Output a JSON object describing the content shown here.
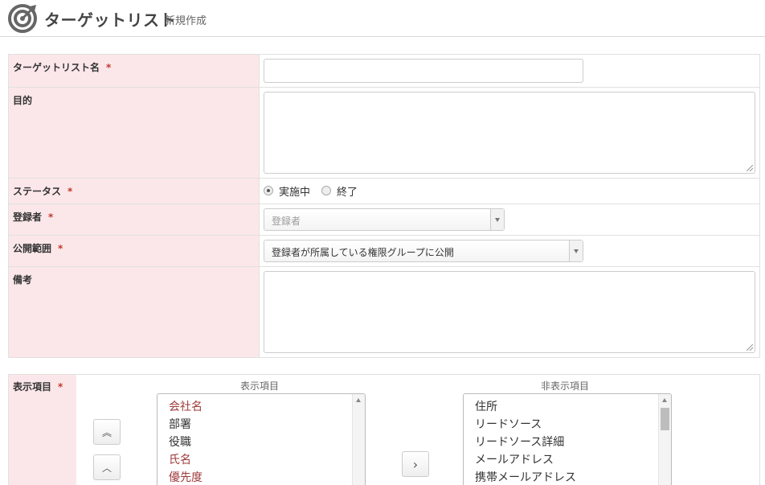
{
  "header": {
    "title": "ターゲットリスト",
    "subtitle": "新規作成",
    "icon": "target-icon"
  },
  "form": {
    "required_mark": "*",
    "name_label": "ターゲットリスト名",
    "name_value": "",
    "purpose_label": "目的",
    "purpose_value": "",
    "status_label": "ステータス",
    "status_options": [
      {
        "label": "実施中",
        "checked": true
      },
      {
        "label": "終了",
        "checked": false
      }
    ],
    "registrant_label": "登録者",
    "registrant_placeholder": "登録者",
    "scope_label": "公開範囲",
    "scope_value": "登録者が所属している権限グループに公開",
    "notes_label": "備考",
    "notes_value": ""
  },
  "display_items": {
    "label": "表示項目",
    "shown_title": "表示項目",
    "hidden_title": "非表示項目",
    "shown": [
      "会社名",
      "部署",
      "役職",
      "氏名",
      "優先度"
    ],
    "shown_red": [
      true,
      false,
      false,
      true,
      true
    ],
    "hidden": [
      "住所",
      "リードソース",
      "リードソース詳細",
      "メールアドレス",
      "携帯メールアドレス"
    ],
    "move_top_symbol": "︽",
    "move_up_symbol": "︿",
    "move_right_symbol": "›"
  },
  "colors": {
    "label_bg": "#fbe7e9",
    "required": "#c0392b",
    "required_item": "#a03a3a"
  }
}
